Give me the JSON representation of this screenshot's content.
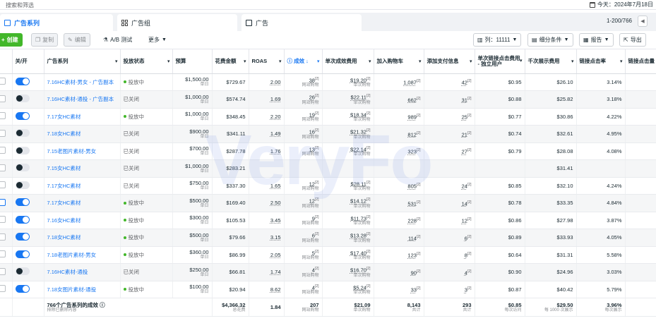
{
  "topbar": {
    "search_placeholder": "搜索和筛选",
    "date_label": "今天：2024年7月18日"
  },
  "tabs": [
    {
      "label": "广告系列",
      "icon": "folder-icon",
      "active": true
    },
    {
      "label": "广告组",
      "icon": "grid-icon",
      "active": false
    },
    {
      "label": "广告",
      "icon": "ad-icon",
      "active": false
    }
  ],
  "pagination": {
    "range": "1-200/766"
  },
  "toolbar": {
    "create": "创建",
    "duplicate": "复制",
    "edit": "编辑",
    "ab_test": "A/B 测试",
    "more": "更多",
    "columns": "列：11111",
    "breakdown": "细分条件",
    "reports": "报告",
    "export": "导出"
  },
  "columns": {
    "toggle": "关/开",
    "campaign": "广告系列",
    "delivery": "投放状态",
    "budget": "预算",
    "spend": "花费金额",
    "roas": "ROAS",
    "results": "成效",
    "cost_per_result": "单次成效费用",
    "add_to_cart": "加入购物车",
    "add_payment": "添加支付信息",
    "cpc_unique": "单次链接点击费用 - 独立用户",
    "cpm": "千次展示费用",
    "ctr": "链接点击率",
    "link_clicks": "链接点击量"
  },
  "sub_labels": {
    "budget": "单日",
    "results": "网站购物",
    "cost_per_result": "单次购物",
    "total_name": "排除已删除内容",
    "total_spend": "总花费",
    "total_results": "网站购物",
    "total_cpr": "单次购物",
    "total_cart": "共计",
    "total_payment": "共计",
    "total_cpc": "每次访问",
    "total_cpm": "每 1000 次展示",
    "total_ctr": "每次展示"
  },
  "status_labels": {
    "active": "投放中",
    "off": "已关闭"
  },
  "rows": [
    {
      "on": true,
      "name": "7.16HC素材-男女 - 广告副本",
      "status": "active",
      "budget": "$1,500.00",
      "spend": "$729.67",
      "roas": "2.00",
      "results": "38",
      "cpr": "$19.20",
      "cart": "1,087",
      "payment": "42",
      "cpc": "$0.95",
      "cpm": "$26.10",
      "ctr": "3.14%"
    },
    {
      "on": false,
      "name": "7.16HC素材-通投 - 广告副本",
      "status": "off",
      "budget": "$1,000.00",
      "spend": "$574.74",
      "roas": "1.69",
      "results": "26",
      "cpr": "$22.11",
      "cart": "662",
      "payment": "31",
      "cpc": "$0.88",
      "cpm": "$25.82",
      "ctr": "3.18%"
    },
    {
      "on": true,
      "name": "7.17女HC素材",
      "status": "active",
      "budget": "$1,000.00",
      "spend": "$348.45",
      "roas": "2.20",
      "results": "19",
      "cpr": "$18.34",
      "cart": "989",
      "payment": "25",
      "cpc": "$0.77",
      "cpm": "$30.86",
      "ctr": "4.22%"
    },
    {
      "on": false,
      "name": "7.18女HC素材",
      "status": "off",
      "budget": "$900.00",
      "spend": "$341.11",
      "roas": "1.49",
      "results": "16",
      "cpr": "$21.32",
      "cart": "812",
      "payment": "21",
      "cpc": "$0.74",
      "cpm": "$32.61",
      "ctr": "4.95%"
    },
    {
      "on": false,
      "name": "7.15老图片素材-男女",
      "status": "off",
      "budget": "$700.00",
      "spend": "$287.78",
      "roas": "1.76",
      "results": "13",
      "cpr": "$22.14",
      "cart": "323",
      "payment": "27",
      "cpc": "$0.79",
      "cpm": "$28.08",
      "ctr": "4.08%"
    },
    {
      "on": false,
      "name": "7.15女HC素材",
      "status": "off",
      "budget": "$1,000.00",
      "spend": "$283.21",
      "roas": "",
      "results": "",
      "cpr": "",
      "cart": "",
      "payment": "",
      "cpc": "",
      "cpm": "$31.41",
      "ctr": ""
    },
    {
      "on": false,
      "name": "7.17女HC素材",
      "status": "off",
      "budget": "$750.00",
      "spend": "$337.30",
      "roas": "1.65",
      "results": "12",
      "cpr": "$28.11",
      "cart": "805",
      "payment": "24",
      "cpc": "$0.85",
      "cpm": "$32.10",
      "ctr": "4.24%"
    },
    {
      "on": true,
      "name": "7.17女HC素材",
      "status": "active",
      "budget": "$500.00",
      "spend": "$169.40",
      "roas": "2.50",
      "results": "12",
      "cpr": "$14.12",
      "cart": "531",
      "payment": "14",
      "cpc": "$0.78",
      "cpm": "$33.35",
      "ctr": "4.84%"
    },
    {
      "on": true,
      "name": "7.16女HC素材",
      "status": "active",
      "budget": "$300.00",
      "spend": "$105.53",
      "roas": "3.45",
      "results": "9",
      "cpr": "$11.73",
      "cart": "228",
      "payment": "12",
      "cpc": "$0.86",
      "cpm": "$27.98",
      "ctr": "3.87%"
    },
    {
      "on": true,
      "name": "7.18女HC素材",
      "status": "active",
      "budget": "$500.00",
      "spend": "$79.66",
      "roas": "3.15",
      "results": "6",
      "cpr": "$13.28",
      "cart": "114",
      "payment": "6",
      "cpc": "$0.89",
      "cpm": "$33.93",
      "ctr": "4.05%"
    },
    {
      "on": true,
      "name": "7.18老图片素材-男女",
      "status": "active",
      "budget": "$360.00",
      "spend": "$86.99",
      "roas": "2.05",
      "results": "5",
      "cpr": "$17.40",
      "cart": "123",
      "payment": "8",
      "cpc": "$0.64",
      "cpm": "$31.31",
      "ctr": "5.58%"
    },
    {
      "on": false,
      "name": "7.16HC素材-通投",
      "status": "off",
      "budget": "$250.00",
      "spend": "$66.81",
      "roas": "1.74",
      "results": "4",
      "cpr": "$16.70",
      "cart": "90",
      "payment": "4",
      "cpc": "$0.90",
      "cpm": "$24.96",
      "ctr": "3.03%"
    },
    {
      "on": true,
      "name": "7.18女图片素材-通投",
      "status": "active",
      "budget": "$100.00",
      "spend": "$20.94",
      "roas": "8.62",
      "results": "4",
      "cpr": "$5.24",
      "cart": "33",
      "payment": "3",
      "cpc": "$0.87",
      "cpm": "$40.42",
      "ctr": "5.79%"
    }
  ],
  "total": {
    "label": "766个广告系列的成效",
    "spend": "$4,366.32",
    "roas": "1.84",
    "results": "207",
    "cpr": "$21.09",
    "cart": "8,143",
    "payment": "293",
    "cpc": "$0.85",
    "cpm": "$29.50",
    "ctr": "3.96%"
  },
  "watermark": "VeryFo",
  "colors": {
    "accent": "#1877f2",
    "create": "#42b72a",
    "active_dot": "#42b72a"
  }
}
